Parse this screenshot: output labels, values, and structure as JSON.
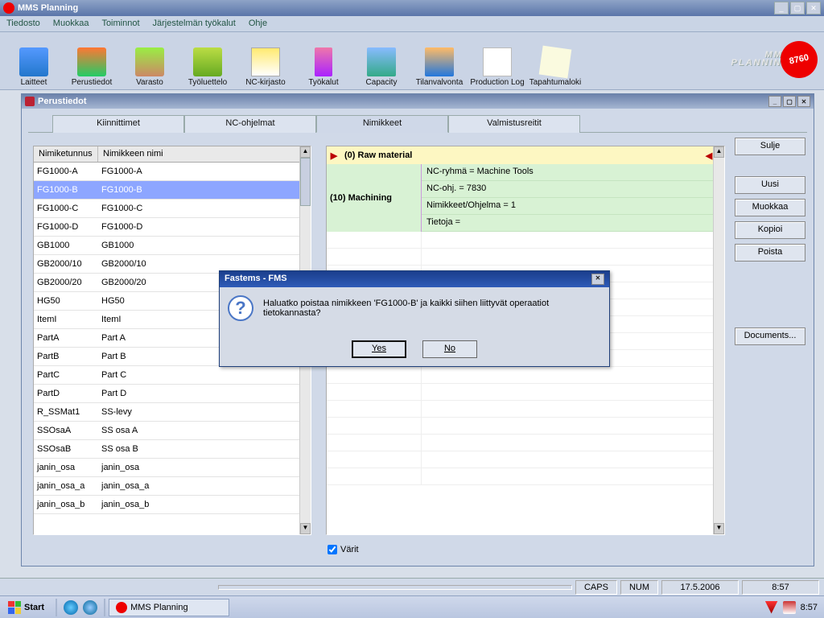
{
  "app": {
    "title": "MMS Planning"
  },
  "menu": [
    "Tiedosto",
    "Muokkaa",
    "Toiminnot",
    "Järjestelmän työkalut",
    "Ohje"
  ],
  "toolbar": [
    {
      "label": "Laitteet",
      "icon": "devices"
    },
    {
      "label": "Perustiedot",
      "icon": "basic"
    },
    {
      "label": "Varasto",
      "icon": "storage"
    },
    {
      "label": "Työluettelo",
      "icon": "worklist"
    },
    {
      "label": "NC-kirjasto",
      "icon": "nclib"
    },
    {
      "label": "Työkalut",
      "icon": "tools"
    },
    {
      "label": "Capacity",
      "icon": "capacity"
    },
    {
      "label": "Tilanvalvonta",
      "icon": "status"
    },
    {
      "label": "Production Log",
      "icon": "prodlog"
    },
    {
      "label": "Tapahtumaloki",
      "icon": "eventlog"
    }
  ],
  "logo": {
    "line1": "MMS",
    "line2": "PLANNING",
    "badge": "8760"
  },
  "child": {
    "title": "Perustiedot",
    "tabs": [
      "Kiinnittimet",
      "NC-ohjelmat",
      "Nimikkeet",
      "Valmistusreitit"
    ],
    "active_tab": 2,
    "table": {
      "headers": {
        "c1": "Nimiketunnus",
        "c2": "Nimikkeen nimi"
      },
      "selected_index": 1,
      "rows": [
        {
          "c1": "FG1000-A",
          "c2": "FG1000-A"
        },
        {
          "c1": "FG1000-B",
          "c2": "FG1000-B"
        },
        {
          "c1": "FG1000-C",
          "c2": "FG1000-C"
        },
        {
          "c1": "FG1000-D",
          "c2": "FG1000-D"
        },
        {
          "c1": "GB1000",
          "c2": "GB1000"
        },
        {
          "c1": "GB2000/10",
          "c2": "GB2000/10"
        },
        {
          "c1": "GB2000/20",
          "c2": "GB2000/20"
        },
        {
          "c1": "HG50",
          "c2": "HG50"
        },
        {
          "c1": "ItemI",
          "c2": "ItemI"
        },
        {
          "c1": "PartA",
          "c2": "Part A"
        },
        {
          "c1": "PartB",
          "c2": "Part B"
        },
        {
          "c1": "PartC",
          "c2": "Part C"
        },
        {
          "c1": "PartD",
          "c2": "Part D"
        },
        {
          "c1": "R_SSMat1",
          "c2": "SS-levy"
        },
        {
          "c1": "SSOsaA",
          "c2": "SS osa A"
        },
        {
          "c1": "SSOsaB",
          "c2": "SS osa B"
        },
        {
          "c1": "janin_osa",
          "c2": "janin_osa"
        },
        {
          "c1": "janin_osa_a",
          "c2": "janin_osa_a"
        },
        {
          "c1": "janin_osa_b",
          "c2": "janin_osa_b"
        }
      ]
    },
    "route": {
      "step0": "(0) Raw material",
      "step1": "(10) Machining",
      "details": [
        "NC-ryhmä = Machine Tools",
        "NC-ohj. = 7830",
        "Nimikkeet/Ohjelma = 1",
        "Tietoja ="
      ]
    },
    "varit_label": "Värit",
    "varit_checked": true,
    "side_buttons": {
      "sulje": "Sulje",
      "uusi": "Uusi",
      "muokkaa": "Muokkaa",
      "kopioi": "Kopioi",
      "poista": "Poista",
      "documents": "Documents..."
    }
  },
  "modal": {
    "title": "Fastems - FMS",
    "message": "Haluatko poistaa nimikkeen 'FG1000-B' ja kaikki siihen liittyvät operaatiot tietokannasta?",
    "yes": "Yes",
    "no": "No"
  },
  "status": {
    "caps": "CAPS",
    "num": "NUM",
    "date": "17.5.2006",
    "time": "8:57"
  },
  "taskbar": {
    "start": "Start",
    "item": "MMS Planning",
    "clock": "8:57"
  }
}
